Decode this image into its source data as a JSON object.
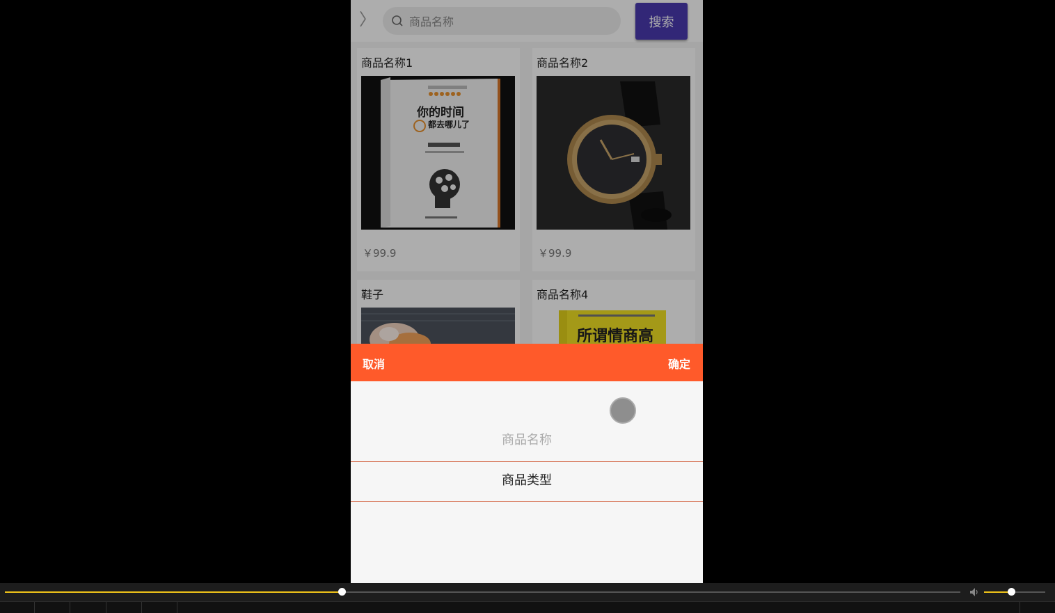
{
  "search": {
    "back_icon": "chevron-right-icon",
    "placeholder": "商品名称",
    "button_label": "搜索",
    "button_color": "#4a3ab0"
  },
  "products": [
    {
      "title": "商品名称1",
      "price": "￥99.9",
      "image": "book-cover-image"
    },
    {
      "title": "商品名称2",
      "price": "￥99.9",
      "image": "wristwatch-image"
    },
    {
      "title": "鞋子",
      "image": "shoe-image"
    },
    {
      "title": "商品名称4",
      "image": "book-cover-image",
      "image_text": "所谓情商高"
    }
  ],
  "book_cover": {
    "title_line1": "你的时间",
    "title_line2": "都去哪儿了"
  },
  "picker": {
    "cancel_label": "取消",
    "confirm_label": "确定",
    "header_color": "#ff5a2a",
    "options": [
      "商品名称",
      "商品类型"
    ],
    "selected_index": 1
  },
  "player": {
    "progress": 0.3525,
    "volume": 0.44,
    "accent_color": "#f0c419",
    "volume_icon": "speaker-icon"
  }
}
